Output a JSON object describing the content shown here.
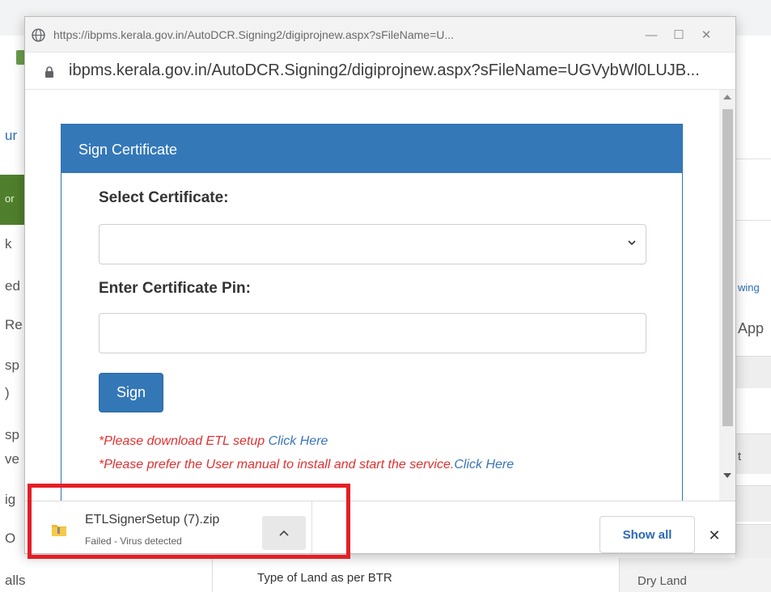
{
  "browser_popup": {
    "title_url": "https://ibpms.kerala.gov.in/AutoDCR.Signing2/digiprojnew.aspx?sFileName=U...",
    "address_url": "ibpms.kerala.gov.in/AutoDCR.Signing2/digiprojnew.aspx?sFileName=UGVybWl0LUJB...",
    "minimize_glyph": "—",
    "maximize_glyph": "☐",
    "close_glyph": "✕"
  },
  "sign_certificate": {
    "header": "Sign Certificate",
    "select_label": "Select Certificate:",
    "select_value": "",
    "pin_label": "Enter Certificate Pin:",
    "pin_value": "",
    "sign_button": "Sign",
    "note1_text": "*Please download ETL setup ",
    "note1_link": "Click Here",
    "note2_text": "*Please prefer the User manual to install and start the service.",
    "note2_link": "Click Here"
  },
  "download_shelf": {
    "file_name": "ETLSignerSetup (7).zip",
    "status": "Failed - Virus detected",
    "show_all": "Show all",
    "close_glyph": "✕"
  },
  "background_page": {
    "left_fragments": [
      "ur",
      "or",
      "k",
      "ed",
      "Re",
      "sp",
      ")",
      "sp",
      "ve",
      "ig",
      "O",
      "alls"
    ],
    "right_fragments": [
      "wing",
      "App",
      "t"
    ],
    "bottom_row_label": "Type of Land as per BTR",
    "bottom_row_value": "Dry Land"
  },
  "colors": {
    "card_header": "#3478b8",
    "sign_button": "#3477b6",
    "note_red": "#e03131",
    "link_blue": "#3a74b6",
    "highlight_red": "#e41e26"
  },
  "icons": {
    "site": "globe-icon",
    "secure": "lock-icon",
    "select": "chevron-down-icon",
    "file": "zip-folder-icon",
    "expand": "chevron-up-icon"
  }
}
